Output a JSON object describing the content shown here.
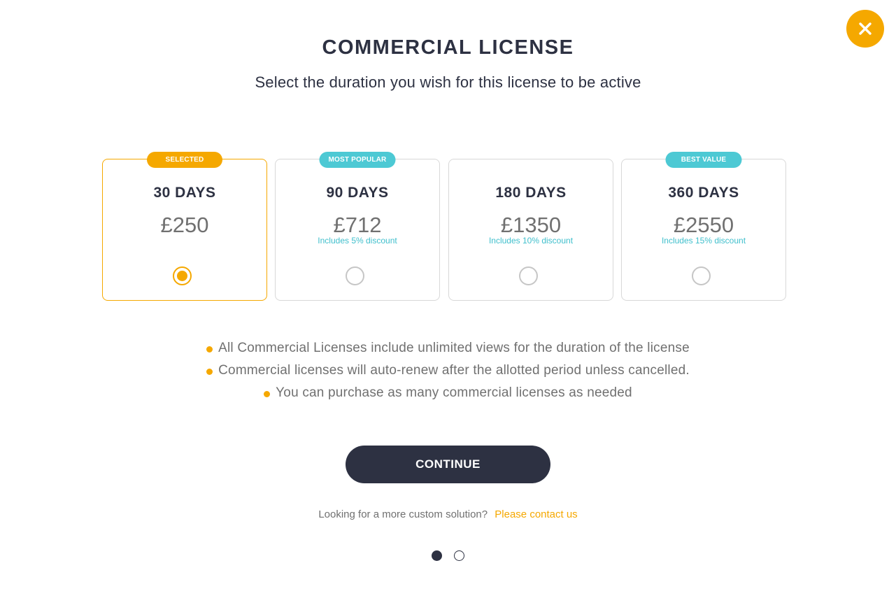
{
  "modal": {
    "title": "COMMERCIAL LICENSE",
    "subtitle": "Select the duration you wish for this license to be active",
    "close_icon": "close-icon",
    "accent_color": "#f5a800",
    "teal_color": "#4dc9d4",
    "dark_color": "#2d3142"
  },
  "plans": [
    {
      "badge": "SELECTED",
      "days": "30 DAYS",
      "price": "£250",
      "discount": "",
      "selected": true
    },
    {
      "badge": "MOST POPULAR",
      "days": "90 DAYS",
      "price": "£712",
      "discount": "Includes 5% discount",
      "selected": false
    },
    {
      "badge": "",
      "days": "180 DAYS",
      "price": "£1350",
      "discount": "Includes 10% discount",
      "selected": false
    },
    {
      "badge": "BEST VALUE",
      "days": "360 DAYS",
      "price": "£2550",
      "discount": "Includes 15% discount",
      "selected": false
    }
  ],
  "notes": [
    "All Commercial Licenses include unlimited views for the duration of the license",
    "Commercial licenses will auto-renew after the allotted period unless cancelled.",
    "You can purchase as many commercial licenses as needed"
  ],
  "actions": {
    "continue_label": "CONTINUE",
    "custom_text": "Looking for a more custom solution?",
    "contact_label": "Please contact us"
  },
  "pagination": {
    "current_page": 1,
    "total_pages": 2
  }
}
